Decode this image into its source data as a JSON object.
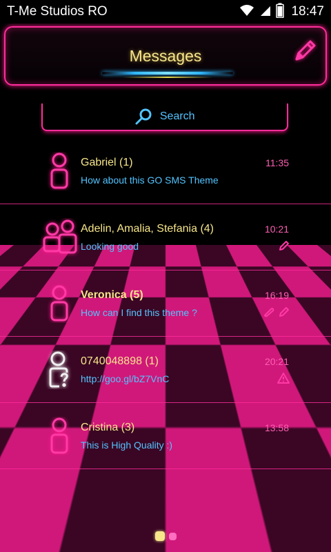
{
  "status_bar": {
    "title": "T-Me Studios RO",
    "time": "18:47",
    "icons": [
      "wifi-icon",
      "signal-icon",
      "battery-icon"
    ]
  },
  "header": {
    "title": "Messages",
    "compose_icon": "pencil-icon"
  },
  "search": {
    "label": "Search",
    "icon": "search-icon"
  },
  "conversations": [
    {
      "name": "Gabriel (1)",
      "snippet": "How about this GO SMS Theme",
      "time": "11:35",
      "avatar": "single-person-icon",
      "bold": false,
      "indicators": []
    },
    {
      "name": "Adelin, Amalia, Stefania (4)",
      "snippet": "Looking good",
      "time": "10:21",
      "avatar": "group-people-icon",
      "bold": false,
      "indicators": [
        "draft-pencil-icon"
      ]
    },
    {
      "name": "Veronica (5)",
      "snippet": "How can I find this theme ?",
      "time": "16:19",
      "avatar": "single-person-icon",
      "bold": true,
      "indicators": [
        "attachment-icon",
        "draft-pencil-icon"
      ]
    },
    {
      "name": "0740048898 (1)",
      "snippet": "http://goo.gl/bZ7VnC",
      "time": "20:21",
      "avatar": "unknown-contact-icon",
      "bold": false,
      "indicators": [
        "warning-icon"
      ]
    },
    {
      "name": "Cristina (3)",
      "snippet": "This is High Quality :)",
      "time": "13:58",
      "avatar": "single-person-icon",
      "bold": false,
      "indicators": []
    }
  ],
  "pager": {
    "pages": 2,
    "current": 1
  },
  "colors": {
    "neon_pink": "#ff2d9b",
    "title_yellow": "#f7e68a",
    "snippet_blue": "#53c4ff",
    "time_pink": "#ff5fb4"
  }
}
